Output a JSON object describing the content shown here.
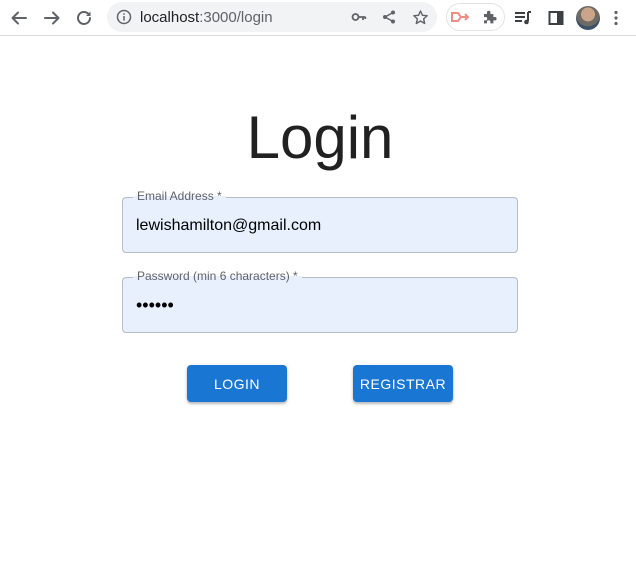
{
  "browser": {
    "url_host": "localhost",
    "url_path": ":3000/login",
    "accent_color": "#1976d2"
  },
  "page": {
    "title": "Login",
    "email_field": {
      "label": "Email Address *",
      "value": "lewishamilton@gmail.com"
    },
    "password_field": {
      "label": "Password (min 6 characters) *",
      "value": "••••••"
    },
    "login_button": "LOGIN",
    "register_button": "REGISTRAR"
  },
  "icons": [
    "back-icon",
    "forward-icon",
    "reload-icon",
    "site-info-icon",
    "key-icon",
    "share-icon",
    "star-icon",
    "extension-app-icon",
    "puzzle-icon",
    "reading-list-icon",
    "side-panel-icon",
    "profile-avatar",
    "kebab-menu-icon"
  ]
}
